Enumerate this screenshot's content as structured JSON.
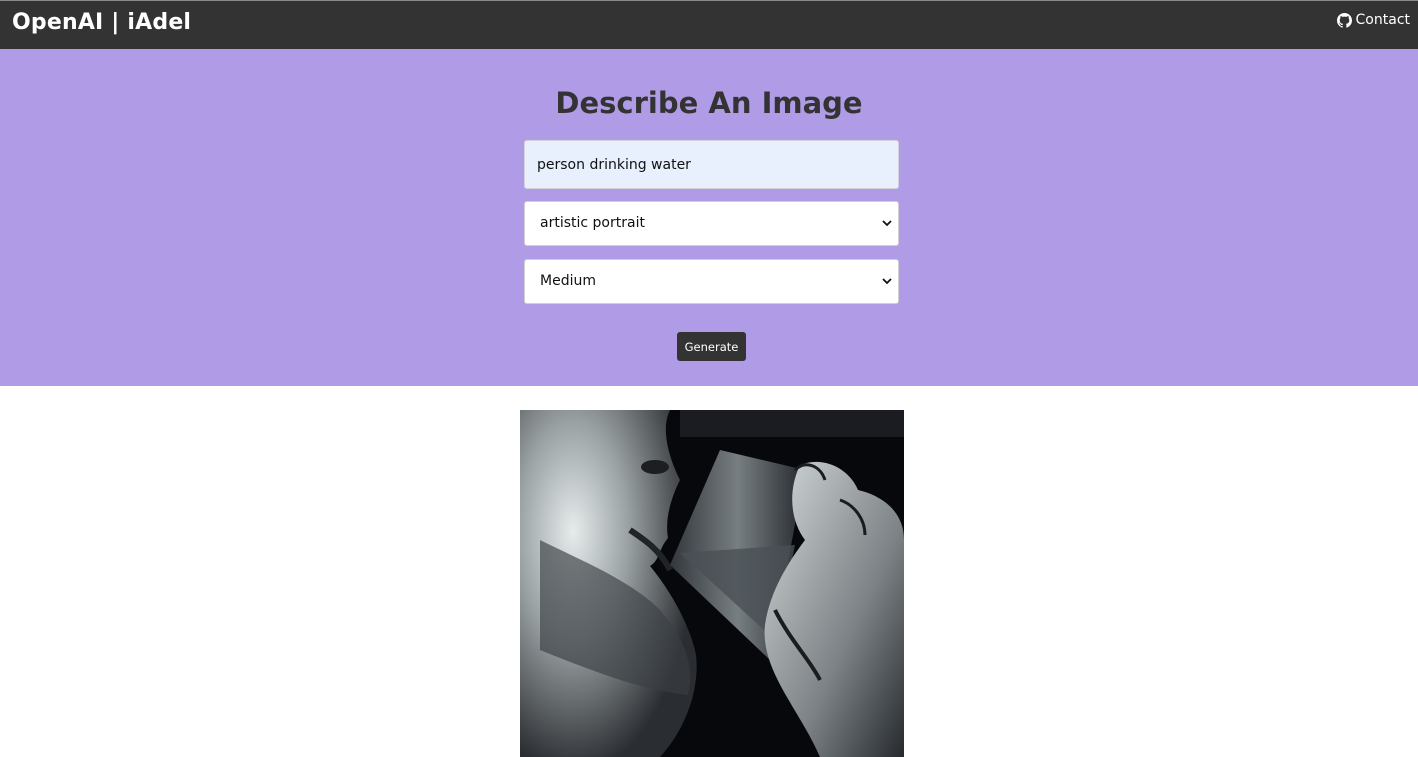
{
  "navbar": {
    "brand": "OpenAI | iAdel",
    "contact_label": "Contact",
    "contact_icon": "github-icon",
    "background": "#333333"
  },
  "hero": {
    "title": "Describe An Image",
    "background": "#b09ce6",
    "prompt": {
      "value": "person drinking water"
    },
    "style_select": {
      "selected": "artistic portrait"
    },
    "size_select": {
      "selected": "Medium"
    },
    "generate_label": "Generate"
  },
  "result": {
    "image": "generated-image"
  }
}
